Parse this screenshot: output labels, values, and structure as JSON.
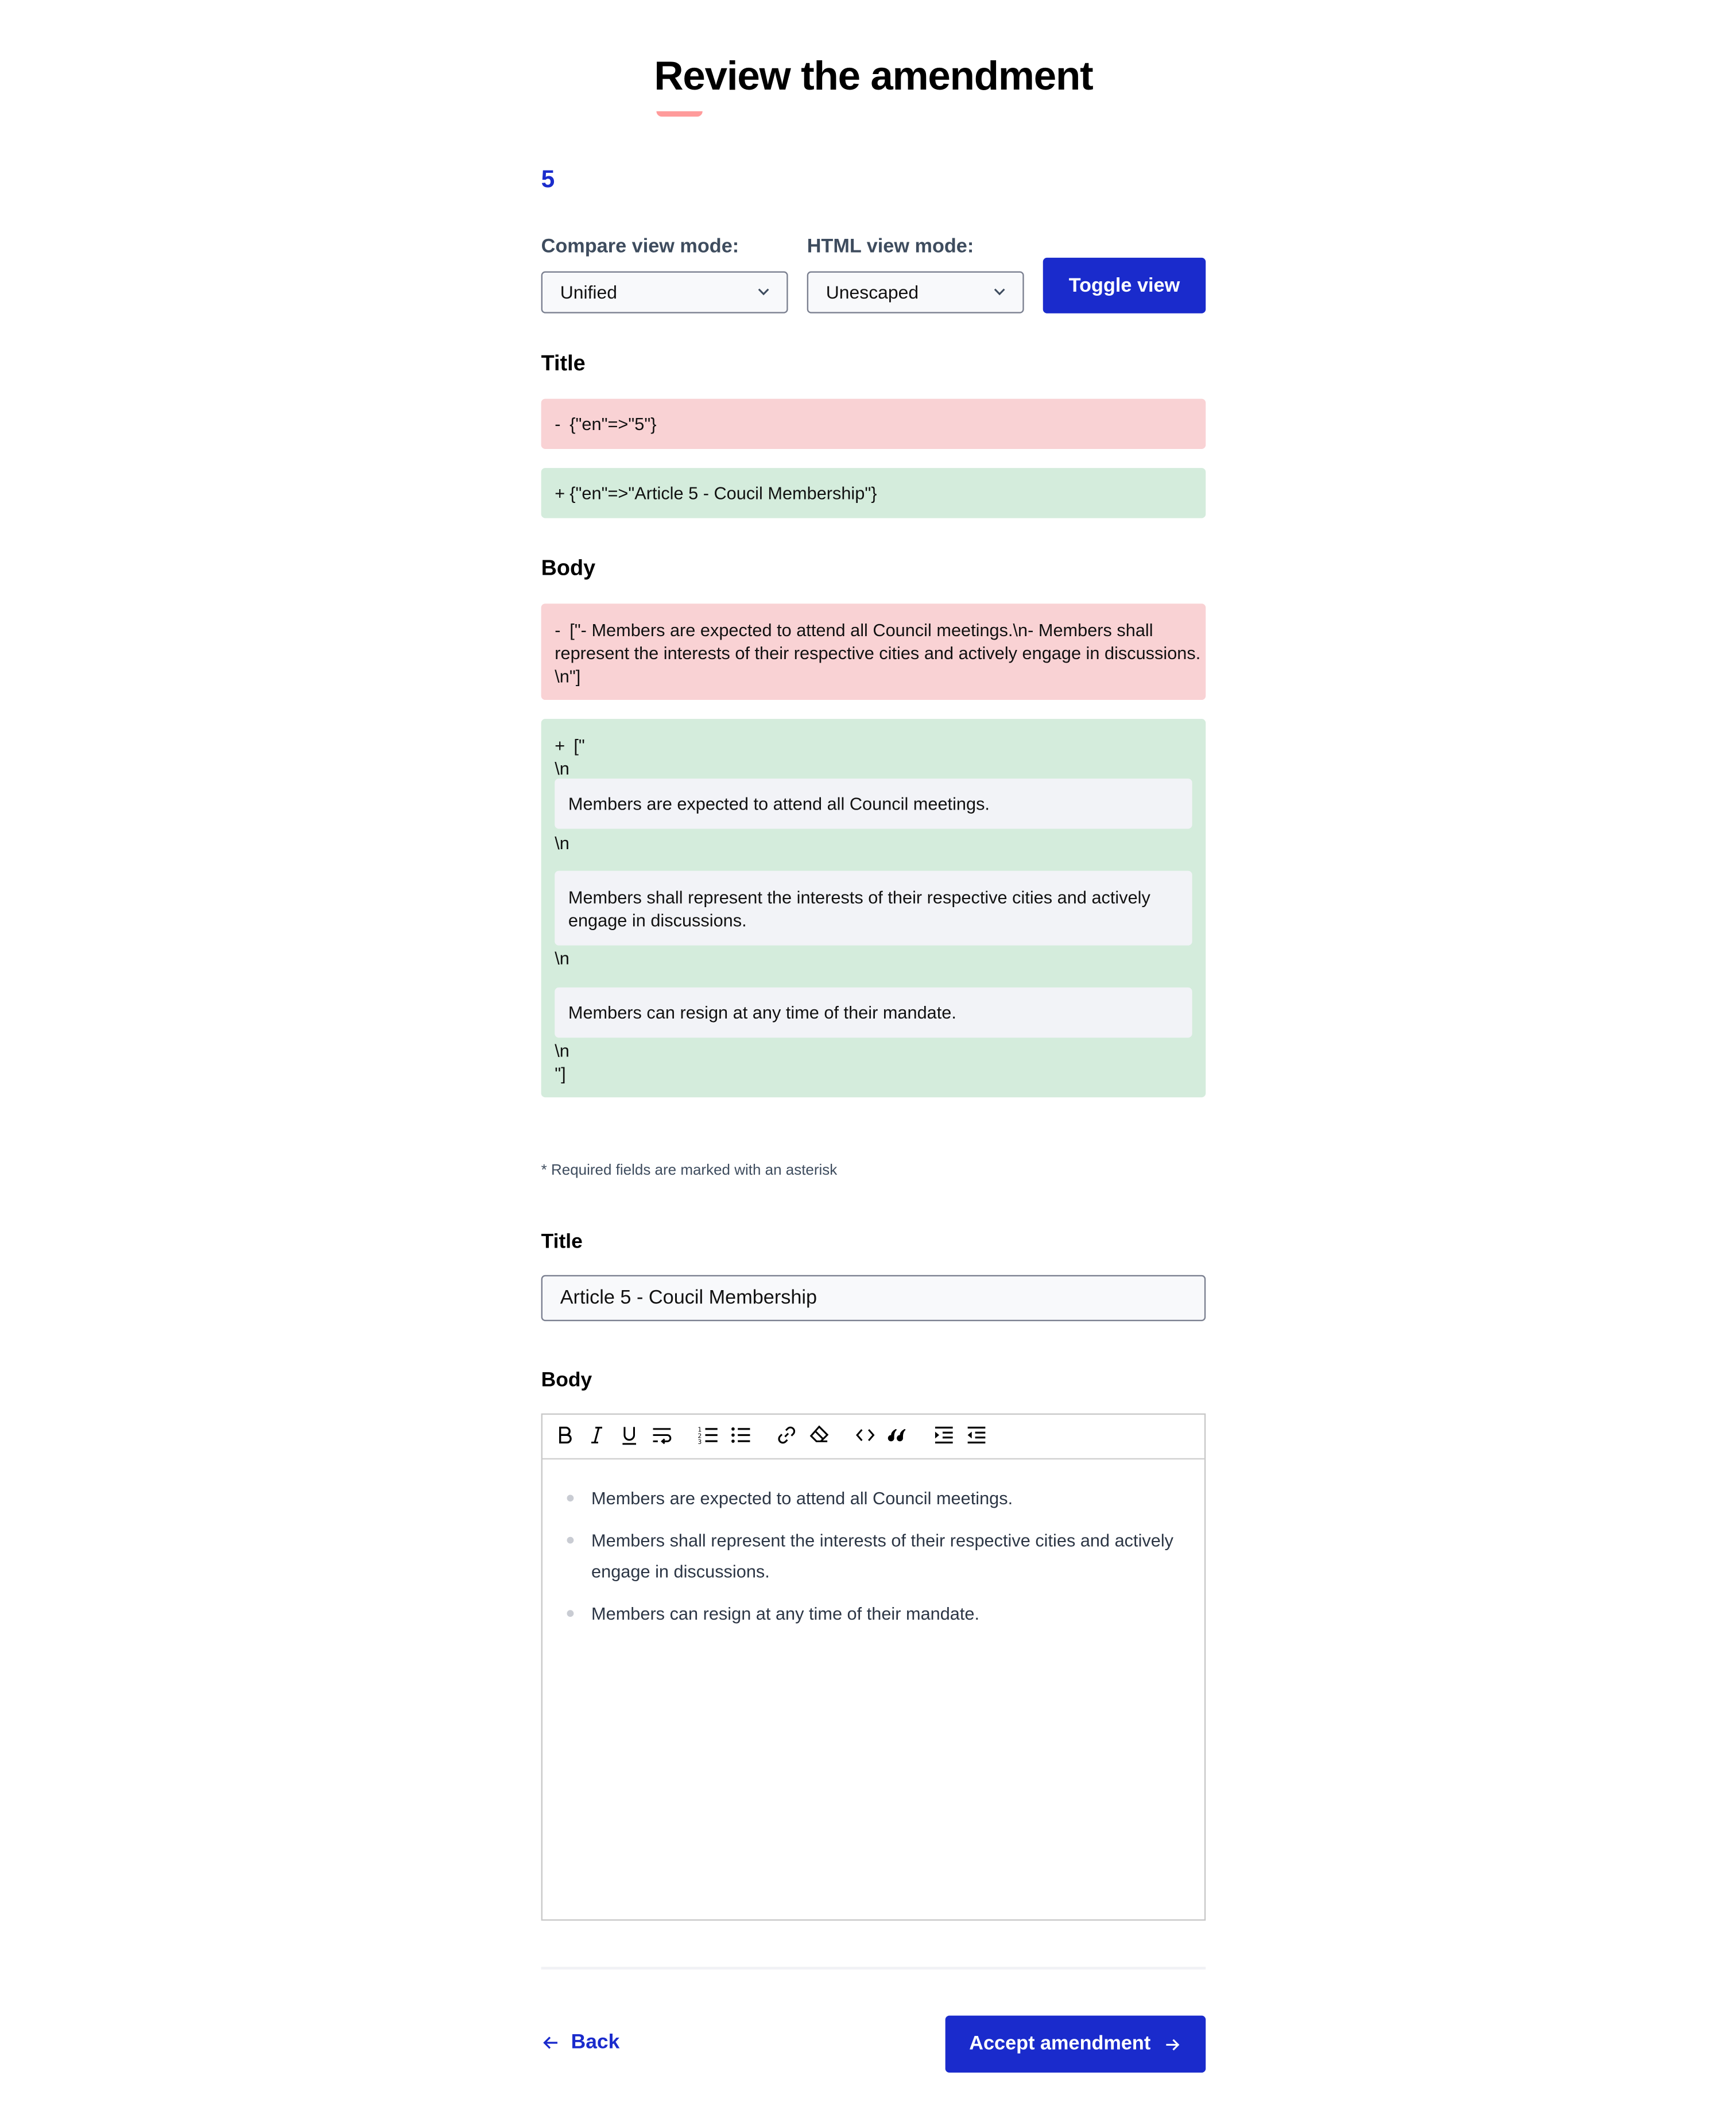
{
  "page": {
    "title": "Review the amendment",
    "amendment_number": "5",
    "colors": {
      "primary": "#1a2bcc",
      "deleted_bg": "#f9d2d4",
      "inserted_bg": "#d4ecdc",
      "underline": "#ff9b9b"
    }
  },
  "controls": {
    "compare_label": "Compare view mode:",
    "compare_value": "Unified",
    "html_label": "HTML view mode:",
    "html_value": "Unescaped",
    "toggle_label": "Toggle view"
  },
  "diff": {
    "title_heading": "Title",
    "title_deleted_sign": "-",
    "title_deleted": "{\"en\"=>\"5\"}",
    "title_inserted_sign": "+",
    "title_inserted": "{\"en\"=>\"Article 5 - Coucil Membership\"}",
    "body_heading": "Body",
    "body_deleted_sign": "-",
    "body_deleted_line1": "[\"- Members are expected to attend all Council meetings.\\n- Members shall",
    "body_deleted_line2": "represent the interests of their respective cities and actively engage in discussions.",
    "body_deleted_line3": "\\n\"]",
    "body_inserted_sign": "+",
    "body_inserted_open": "[\"",
    "newline_marker": "\\n",
    "body_inserted_close": "\"]",
    "body_inserted_paragraphs": [
      "Members are expected to attend all Council meetings.",
      "Members shall represent the interests of their respective cities and actively engage in discussions.",
      "Members can resign at any time of their mandate."
    ]
  },
  "form": {
    "required_note": "* Required fields are marked with an asterisk",
    "title_label": "Title",
    "title_value": "Article 5 - Coucil Membership",
    "body_label": "Body",
    "toolbar": [
      {
        "name": "bold-icon",
        "label": "Bold"
      },
      {
        "name": "italic-icon",
        "label": "Italic"
      },
      {
        "name": "underline-icon",
        "label": "Underline"
      },
      {
        "name": "hard-break-icon",
        "label": "Hard break"
      },
      {
        "name": "ordered-list-icon",
        "label": "Ordered list"
      },
      {
        "name": "bullet-list-icon",
        "label": "Bullet list"
      },
      {
        "name": "link-icon",
        "label": "Link"
      },
      {
        "name": "eraser-icon",
        "label": "Clear formatting"
      },
      {
        "name": "code-icon",
        "label": "Code"
      },
      {
        "name": "quote-icon",
        "label": "Blockquote"
      },
      {
        "name": "indent-icon",
        "label": "Indent"
      },
      {
        "name": "outdent-icon",
        "label": "Outdent"
      }
    ],
    "body_items": [
      "Members are expected to attend all Council meetings.",
      "Members shall represent the interests of their respective cities and actively engage in discussions.",
      "Members can resign at any time of their mandate."
    ]
  },
  "footer": {
    "back_label": "Back",
    "accept_label": "Accept amendment"
  }
}
